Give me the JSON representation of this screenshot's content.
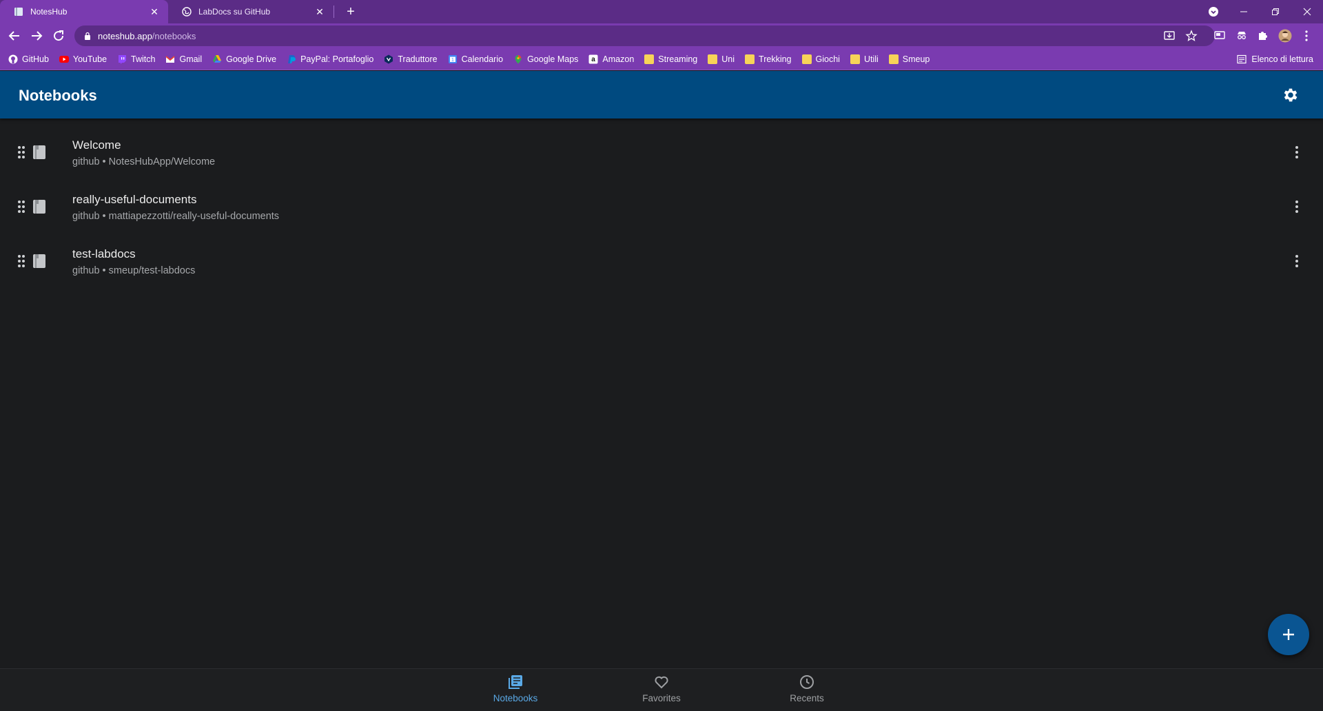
{
  "browser": {
    "tabs": [
      {
        "title": "NotesHub",
        "active": true
      },
      {
        "title": "LabDocs su GitHub",
        "active": false
      }
    ],
    "new_tab": "+",
    "address": {
      "host": "noteshub.app",
      "path": "/notebooks"
    },
    "bookmarks": [
      {
        "label": "GitHub",
        "icon": "github-icon",
        "color": "#ffffff"
      },
      {
        "label": "YouTube",
        "icon": "youtube-icon",
        "color": "#ff0000"
      },
      {
        "label": "Twitch",
        "icon": "twitch-icon",
        "color": "#9146ff"
      },
      {
        "label": "Gmail",
        "icon": "gmail-icon",
        "color": "#ea4335"
      },
      {
        "label": "Google Drive",
        "icon": "drive-icon",
        "color": "#34a853"
      },
      {
        "label": "PayPal: Portafoglio",
        "icon": "paypal-icon",
        "color": "#1f64c9"
      },
      {
        "label": "Traduttore",
        "icon": "translator-icon",
        "color": "#0b2a5a"
      },
      {
        "label": "Calendario",
        "icon": "calendar-icon",
        "color": "#4285f4"
      },
      {
        "label": "Google Maps",
        "icon": "maps-icon",
        "color": "#34a853"
      },
      {
        "label": "Amazon",
        "icon": "amazon-icon",
        "color": "#ffffff"
      },
      {
        "label": "Streaming",
        "icon": "folder-icon",
        "color": "#f7d358"
      },
      {
        "label": "Uni",
        "icon": "folder-icon",
        "color": "#f7d358"
      },
      {
        "label": "Trekking",
        "icon": "folder-icon",
        "color": "#f7d358"
      },
      {
        "label": "Giochi",
        "icon": "folder-icon",
        "color": "#f7d358"
      },
      {
        "label": "Utili",
        "icon": "folder-icon",
        "color": "#f7d358"
      },
      {
        "label": "Smeup",
        "icon": "folder-icon",
        "color": "#f7d358"
      }
    ],
    "reading_list": "Elenco di lettura"
  },
  "app": {
    "title": "Notebooks",
    "notebooks": [
      {
        "name": "Welcome",
        "source": "github • NotesHubApp/Welcome"
      },
      {
        "name": "really-useful-documents",
        "source": "github • mattiapezzotti/really-useful-documents"
      },
      {
        "name": "test-labdocs",
        "source": "github • smeup/test-labdocs"
      }
    ],
    "fab": "+",
    "nav": [
      {
        "label": "Notebooks",
        "icon": "notebooks-icon",
        "active": true
      },
      {
        "label": "Favorites",
        "icon": "heart-icon",
        "active": false
      },
      {
        "label": "Recents",
        "icon": "clock-icon",
        "active": false
      }
    ],
    "colors": {
      "appbar": "#004a80",
      "accent": "#5aa9e6",
      "background": "#1b1c1e"
    }
  }
}
